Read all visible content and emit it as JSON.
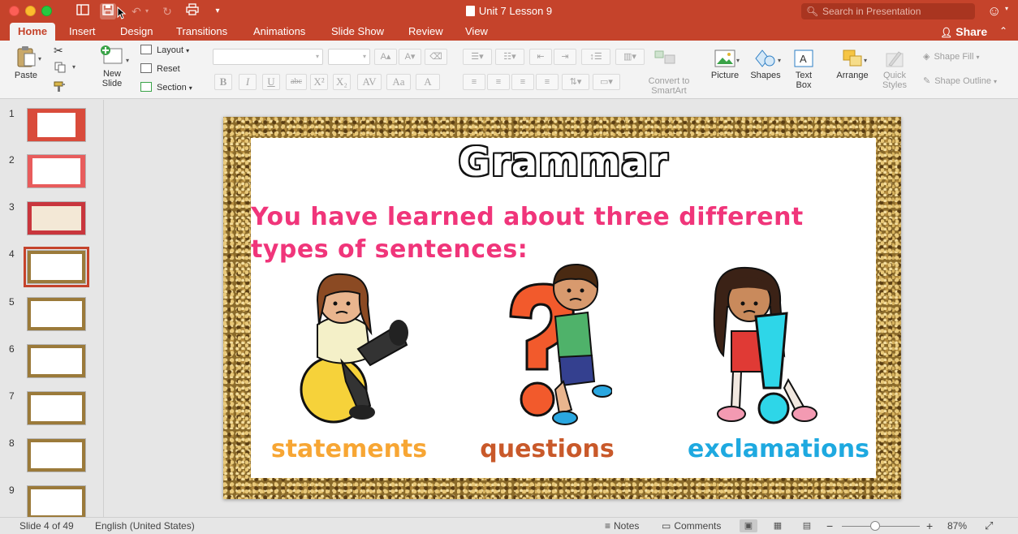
{
  "window": {
    "title": "Unit 7 Lesson 9",
    "search_placeholder": "Search in Presentation"
  },
  "tabs": [
    "Home",
    "Insert",
    "Design",
    "Transitions",
    "Animations",
    "Slide Show",
    "Review",
    "View"
  ],
  "active_tab": "Home",
  "share_label": "Share",
  "ribbon": {
    "paste": "Paste",
    "new_slide_1": "New",
    "new_slide_2": "Slide",
    "layout": "Layout",
    "reset": "Reset",
    "section": "Section",
    "convert_1": "Convert to",
    "convert_2": "SmartArt",
    "picture": "Picture",
    "shapes": "Shapes",
    "text_box_1": "Text",
    "text_box_2": "Box",
    "arrange": "Arrange",
    "quick_styles_1": "Quick",
    "quick_styles_2": "Styles",
    "shape_fill": "Shape Fill",
    "shape_outline": "Shape Outline"
  },
  "thumbnails": [
    "1",
    "2",
    "3",
    "4",
    "5",
    "6",
    "7",
    "8",
    "9"
  ],
  "selected_slide": 4,
  "slide": {
    "title": "Grammar",
    "subtitle": "You have learned about three different types of sentences:",
    "captions": [
      "statements",
      "questions",
      "exclamations"
    ],
    "caption_colors": [
      "#f7a634",
      "#c9592a",
      "#1ea9e0"
    ]
  },
  "status": {
    "slide_counter": "Slide 4 of 49",
    "language": "English (United States)",
    "notes": "Notes",
    "comments": "Comments",
    "zoom": "87%"
  },
  "colors": {
    "accent": "#c5432b",
    "pink_text": "#f0357a"
  }
}
